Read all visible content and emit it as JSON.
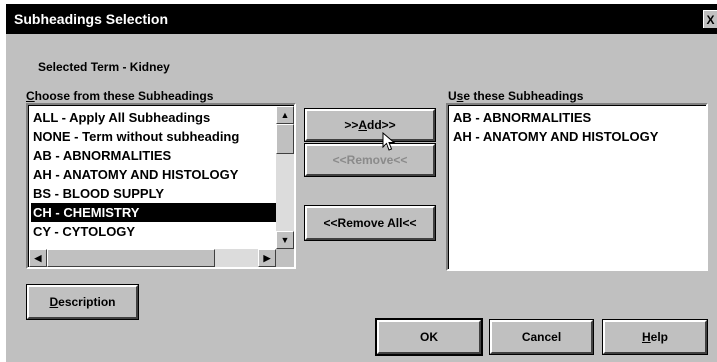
{
  "window": {
    "title": "Subheadings Selection",
    "close_glyph": "X"
  },
  "selected_term": "Selected Term - Kidney",
  "choose_list": {
    "label_pre": "",
    "label_hotkey": "C",
    "label_post": "hoose from these Subheadings",
    "items": [
      "ALL - Apply All Subheadings",
      "NONE - Term without subheading",
      "AB - ABNORMALITIES",
      "AH - ANATOMY AND HISTOLOGY",
      "BS - BLOOD SUPPLY",
      "CH - CHEMISTRY",
      "CY - CYTOLOGY"
    ],
    "selected_index": 5
  },
  "use_list": {
    "label_pre": "U",
    "label_hotkey": "s",
    "label_post": "e these Subheadings",
    "items": [
      "AB - ABNORMALITIES",
      "AH - ANATOMY AND HISTOLOGY"
    ]
  },
  "buttons": {
    "add": {
      "pre": ">>",
      "hotkey": "A",
      "post": "dd>>",
      "disabled": false
    },
    "remove": {
      "label": "<<Remove<<",
      "disabled": true
    },
    "remove_all": {
      "pre": "<<Remove",
      "hotkey": "",
      "mid": " All<<",
      "disabled": false
    },
    "description": {
      "pre": "",
      "hotkey": "D",
      "post": "escription"
    },
    "ok": {
      "label": "OK"
    },
    "cancel": {
      "label": "Cancel"
    },
    "help": {
      "pre": "",
      "hotkey": "H",
      "post": "elp"
    }
  },
  "icons": {
    "scroll_up": "scroll-up-arrow-icon",
    "scroll_down": "scroll-down-arrow-icon",
    "scroll_left": "scroll-left-arrow-icon",
    "scroll_right": "scroll-right-arrow-icon",
    "cursor": "mouse-pointer-icon"
  },
  "colors": {
    "dialog_bg": "#c0c0c0",
    "titlebar_bg": "#000000",
    "selection_bg": "#000000",
    "disabled_text": "#8a8a8a"
  }
}
